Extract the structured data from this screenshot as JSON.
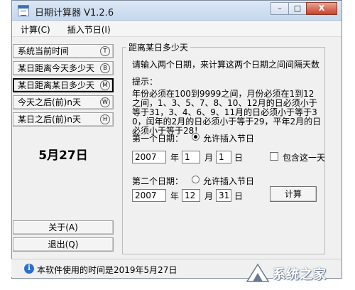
{
  "window": {
    "title": "日期计算器 V1.2.6",
    "controls": {
      "minimize": "–",
      "maximize": "□",
      "close": "X"
    }
  },
  "menu": [
    "计算(C)",
    "插入节日(I)"
  ],
  "left_buttons": [
    {
      "label": "系统当前时间",
      "hotkey": "T",
      "active": false
    },
    {
      "label": "某日距离今天多少天",
      "hotkey": "B",
      "active": false
    },
    {
      "label": "某日距离某日多少天",
      "hotkey": "M",
      "active": true
    },
    {
      "label": "今天之后(前)n天",
      "hotkey": "W",
      "active": false
    },
    {
      "label": "某日之后(前)n天",
      "hotkey": "H",
      "active": false
    }
  ],
  "current_date": "5月27日",
  "bottom_buttons": {
    "about": "关于(A)",
    "exit": "退出(Q)"
  },
  "panel": {
    "title": "距离某日多少天",
    "instruction": "请输入两个日期，来计算这两个日期之间间隔天数",
    "hint_label": "提示：",
    "hint_text": "年份必须在100到9999之间，月份必须在1到12之间，1、3、5、7、8、10、12月的日必须小于等于31，3、4、6、9、11月的日必须小于等于30，闰年的2月的日必须小于等于29，平年2月的日必须小于等于28！",
    "date1_label": "第一个日期：",
    "date1_radio": "允许插入节日",
    "date1_radio_checked": true,
    "date1": {
      "year": "2007",
      "month": "1",
      "day": "1"
    },
    "include_day_label": "包含这一天",
    "include_day_checked": false,
    "date2_label": "第二个日期：",
    "date2_radio": "允许插入节日",
    "date2_radio_checked": false,
    "date2": {
      "year": "2007",
      "month": "12",
      "day": "31"
    },
    "unit_year": "年",
    "unit_month": "月",
    "unit_day": "日",
    "calc_button": "计算"
  },
  "status": {
    "text": "本软件使用的时间是2019年5月27日"
  },
  "watermark": {
    "text": "系统之家"
  }
}
